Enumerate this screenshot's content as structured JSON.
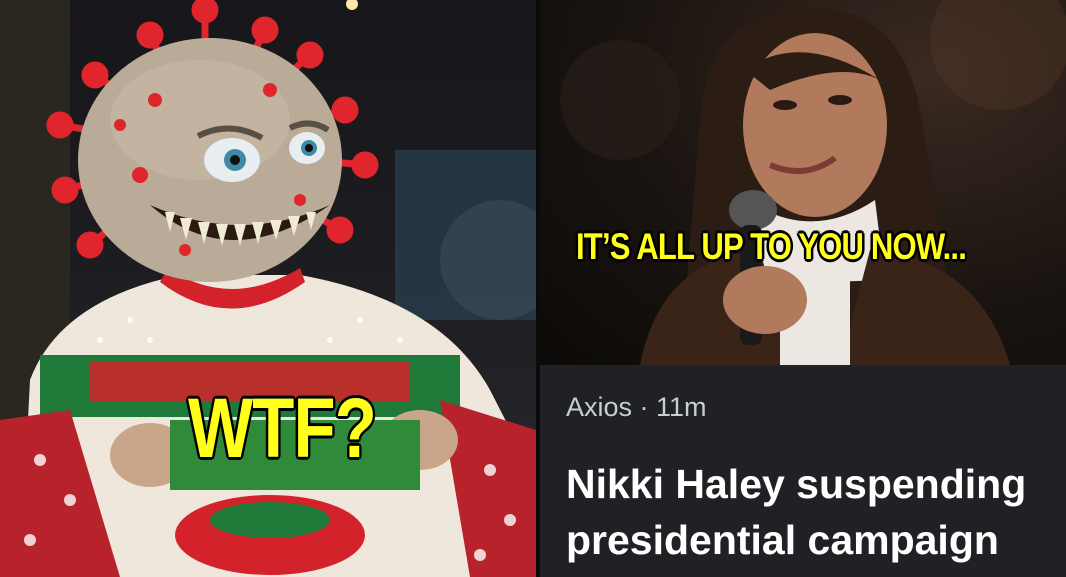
{
  "left_panel": {
    "caption": "WTF?",
    "colors": {
      "caption": "#ffff1a",
      "sweater_red": "#d3222a",
      "sweater_green": "#1f7a3a",
      "virus_head": "#b9ab97",
      "spikes": "#e0262c"
    }
  },
  "right_panel": {
    "caption": "IT’S ALL UP TO YOU NOW...",
    "news_card": {
      "source": "Axios · 11m",
      "headline": "Nikki Haley suspending presidential campaign"
    },
    "colors": {
      "card_background": "#1f2124",
      "source_text": "#c9ccd1",
      "headline_text": "#ffffff"
    }
  }
}
